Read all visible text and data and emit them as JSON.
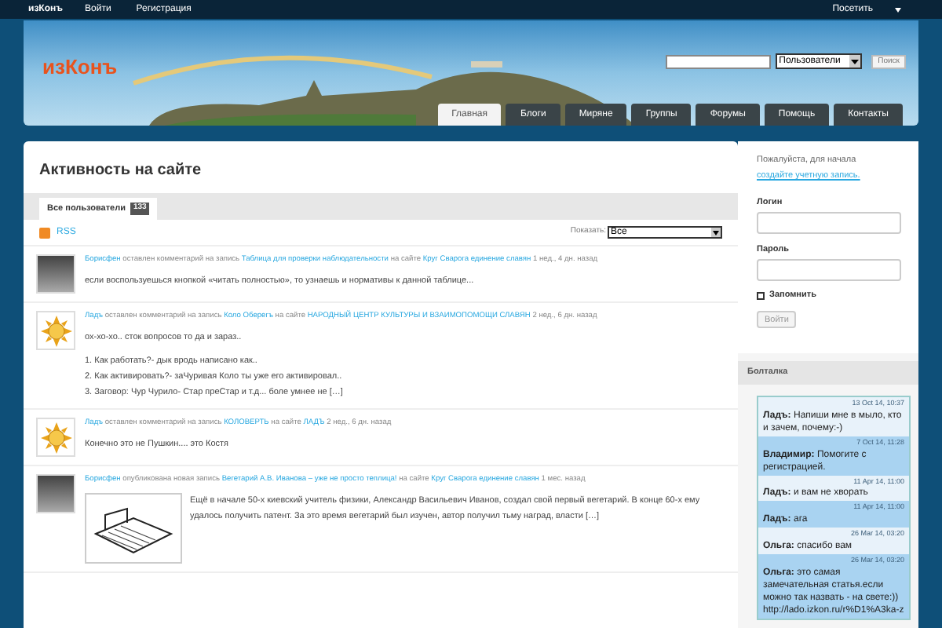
{
  "topbar": {
    "brand": "изКонъ",
    "links": [
      "Войти",
      "Регистрация"
    ],
    "visit": "Посетить"
  },
  "header": {
    "logo": "изКонъ",
    "search": {
      "scope": "Пользователи",
      "button": "Поиск"
    },
    "nav": [
      {
        "label": "Главная",
        "selected": true
      },
      {
        "label": "Блоги",
        "selected": false
      },
      {
        "label": "Миряне",
        "selected": false
      },
      {
        "label": "Группы",
        "selected": false
      },
      {
        "label": "Форумы",
        "selected": false
      },
      {
        "label": "Помощь",
        "selected": false
      },
      {
        "label": "Контакты",
        "selected": false
      }
    ]
  },
  "main": {
    "title": "Активность на сайте",
    "tabs": [
      {
        "label": "Все пользователи",
        "count": "133",
        "selected": true
      }
    ],
    "rss": "RSS",
    "show_label": "Показать:",
    "show_value": "Все",
    "items": [
      {
        "kind": "photo",
        "user": "Борисфен",
        "action": "оставлен комментарий на запись",
        "post": "Таблица для проверки наблюдательности",
        "site_prefix": "на сайте",
        "site": "Круг Сварога единение славян",
        "time": "1 нед., 4 дн. назад",
        "paragraphs": [
          "если воспользуешься кнопкой «читать полностью», то узнаешь и нормативы к данной таблице..."
        ]
      },
      {
        "kind": "sun",
        "user": "Ладъ",
        "action": "оставлен комментарий на запись",
        "post": "Коло Оберегъ",
        "site_prefix": "на сайте",
        "site": "НАРОДНЫЙ ЦЕНТР КУЛЬТУРЫ И ВЗАИМОПОМОЩИ СЛАВЯН",
        "time": "2 нед., 6 дн. назад",
        "paragraphs": [
          "ох-хо-хо.. сток вопросов то да и зараз..",
          "1. Как работать?- дык вродь написано как..\n2. Как активировать?- заЧуривая Коло ты уже его активировал..\n3. Заговор: Чур Чурило- Стар преСтар и т.д... боле умнее не […]"
        ]
      },
      {
        "kind": "sun",
        "user": "Ладъ",
        "action": "оставлен комментарий на запись",
        "post": "КОЛОВЕРТЬ",
        "site_prefix": "на сайте",
        "site": "ЛАДЪ",
        "time": "2 нед., 6 дн. назад",
        "paragraphs": [
          "Конечно это не Пушкин.... это Костя"
        ]
      },
      {
        "kind": "photo",
        "user": "Борисфен",
        "action": "опубликована новая запись",
        "post": "Вегетарий А.В. Иванова – уже не просто теплица!",
        "site_prefix": "на сайте",
        "site": "Круг Сварога единение славян",
        "time": "1 мес. назад",
        "image": true,
        "paragraphs": [
          "Ещё в начале 50-х киевский учитель физики, Александр Васильевич Иванов, создал свой первый вегетарий. В конце 60-х ему удалось получить патент. За это время вегетарий был изучен, автор получил тьму наград, власти […]"
        ]
      }
    ]
  },
  "sidebar": {
    "intro": "Пожалуйста, для начала",
    "register_link": "создайте учетную запись.",
    "login_label": "Логин",
    "password_label": "Пароль",
    "remember": {
      "label": "Запомнить",
      "checked": false
    },
    "submit": "Войти",
    "chat": {
      "title": "Болталка",
      "messages": [
        {
          "time": "13 Oct 14, 10:37",
          "author": "Ладъ:",
          "text": "Напиши мне в мыло, кто и зачем, почему:-)"
        },
        {
          "time": "7 Oct 14, 11:28",
          "author": "Владимир:",
          "text": "Помогите с регистрацией."
        },
        {
          "time": "11 Apr 14, 11:00",
          "author": "Ладъ:",
          "text": "и вам не хворать"
        },
        {
          "time": "11 Apr 14, 11:00",
          "author": "Ладъ:",
          "text": "ага"
        },
        {
          "time": "26 Mar 14, 03:20",
          "author": "Ольга:",
          "text": "спасибо вам"
        },
        {
          "time": "26 Mar 14, 03:20",
          "author": "Ольга:",
          "text": "это самая замечательная статья.если можно так назвать - на свете:)) http://lado.izkon.ru/r%D1%A3ka-z"
        }
      ]
    }
  }
}
